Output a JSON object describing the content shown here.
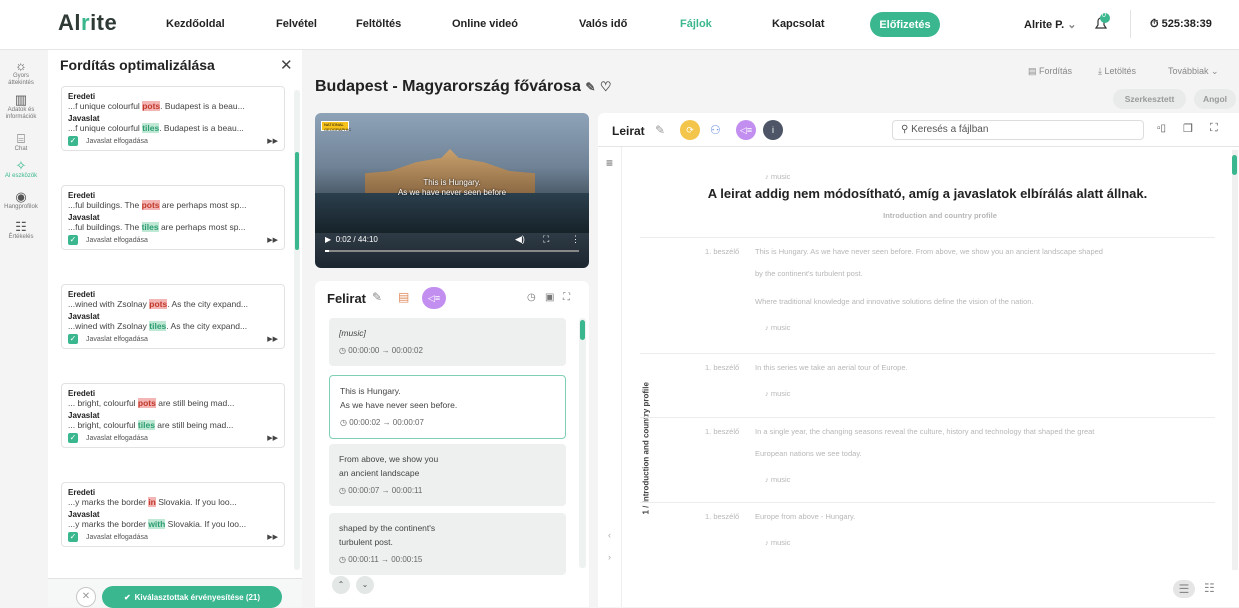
{
  "brand": {
    "logo_a": "Al",
    "logo_i": "r",
    "logo_rest": "ite",
    "accent": "#3bb78f"
  },
  "nav": {
    "items": [
      "Kezdőoldal",
      "Felvétel",
      "Feltöltés",
      "Online videó",
      "Valós idő",
      "Fájlok",
      "Kapcsolat"
    ],
    "active": "Fájlok",
    "premium": "Előfizetés",
    "user": "Alrite P.",
    "notif_count": "0",
    "timer": "525:38:39"
  },
  "rail": [
    {
      "label": "Gyors áttekintés",
      "icon": "bulb-icon"
    },
    {
      "label": "Adatok és információk",
      "icon": "chart-icon"
    },
    {
      "label": "Chat",
      "icon": "chat-icon"
    },
    {
      "label": "AI eszközök",
      "icon": "ai-tools-icon"
    },
    {
      "label": "Hangprofilok",
      "icon": "voice-icon"
    },
    {
      "label": "Értékelés",
      "icon": "rating-icon"
    }
  ],
  "suggestions": {
    "title": "Fordítás optimalizálása",
    "original_label": "Eredeti",
    "suggestion_label": "Javaslat",
    "accept_label": "Javaslat elfogadása",
    "cards": [
      {
        "orig_pre": "...f unique colourful ",
        "orig_word": "pots",
        "orig_post": ". Budapest is a beau...",
        "sug_pre": "...f unique colourful ",
        "sug_word": "tiles",
        "sug_post": ". Budapest is a beau..."
      },
      {
        "orig_pre": "...ful buildings. The ",
        "orig_word": "pots",
        "orig_post": " are perhaps most sp...",
        "sug_pre": "...ful buildings. The ",
        "sug_word": "tiles",
        "sug_post": " are perhaps most sp..."
      },
      {
        "orig_pre": "...wined with Zsolnay ",
        "orig_word": "pots",
        "orig_post": ". As the city expand...",
        "sug_pre": "...wined with Zsolnay ",
        "sug_word": "tiles",
        "sug_post": ". As the city expand..."
      },
      {
        "orig_pre": "... bright, colourful ",
        "orig_word": "pots",
        "orig_post": " are still being mad...",
        "sug_pre": "... bright, colourful ",
        "sug_word": "tiles",
        "sug_post": " are still being mad..."
      },
      {
        "orig_pre": "...y marks the border ",
        "orig_word": "in",
        "orig_post": " Slovakia. If you loo...",
        "sug_pre": "...y marks the border ",
        "sug_word": "with",
        "sug_post": " Slovakia. If you loo..."
      }
    ],
    "apply_button": "Kiválasztottak érvényesítése (21)"
  },
  "document": {
    "title": "Budapest - Magyarország fővárosa",
    "links": [
      "Fordítás",
      "Letöltés",
      "Továbbiak"
    ],
    "pills": [
      "Szerkesztett",
      "Angol"
    ]
  },
  "video": {
    "badge": "NATIONAL GEOGRAPHIC",
    "sub1": "This is Hungary.",
    "sub2": "As we have never seen before",
    "time": "0:02 / 44:10",
    "progress_fraction": 0.0008
  },
  "subtitles": {
    "title": "Felirat",
    "items": [
      {
        "text1": "[music]",
        "text2": "",
        "time": "00:00:00 → 00:00:02"
      },
      {
        "text1": "This is Hungary.",
        "text2": "As we have never seen before.",
        "time": "00:00:02 → 00:00:07"
      },
      {
        "text1": "From above, we show you",
        "text2": "an ancient landscape",
        "time": "00:00:07 → 00:00:11"
      },
      {
        "text1": "shaped by the continent's",
        "text2": "turbulent post.",
        "time": "00:00:11 → 00:00:15"
      }
    ]
  },
  "description": {
    "title": "Leirat",
    "search_placeholder": "Keresés a fájlban",
    "notice": "A leirat addig nem módosítható, amíg a javaslatok elbírálás alatt állnak.",
    "chapter": "1 / Introduction and country profile",
    "faded_music": "music",
    "faded_heading": "Introduction and country profile",
    "rows": [
      {
        "speaker": "1. beszélő",
        "lines": [
          "This is Hungary. As we have never seen before. From above, we show you an ancient landscape shaped",
          "by the continent's turbulent post.",
          "Where traditional knowledge and innovative solutions define the vision of the nation."
        ],
        "music": "music"
      },
      {
        "speaker": "1. beszélő",
        "lines": [
          "In this series we take an aerial tour of Europe."
        ],
        "music": "music"
      },
      {
        "speaker": "1. beszélő",
        "lines": [
          "In a single year, the changing seasons reveal the culture, history and technology that shaped the great",
          "European nations we see today."
        ],
        "music": "music"
      },
      {
        "speaker": "1. beszélő",
        "lines": [
          "Europe from above - Hungary."
        ],
        "music": "music"
      }
    ]
  }
}
